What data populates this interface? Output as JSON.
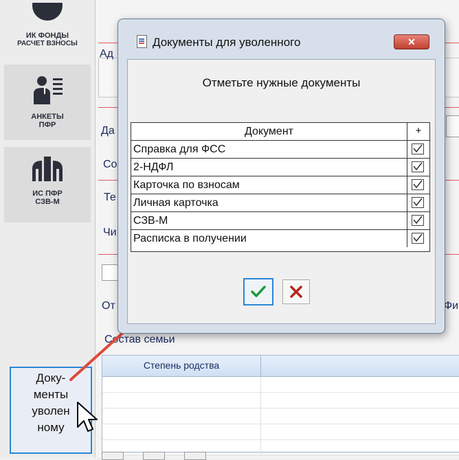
{
  "sidebar": {
    "items": [
      {
        "icon": "ik-funds-icon",
        "label_line1": "ИК ФОНДЫ",
        "label_line2": "РАСЧЕТ ВЗНОСЫ"
      },
      {
        "icon": "person-list-icon",
        "label_line1": "АНКЕТЫ",
        "label_line2": "ПФР"
      },
      {
        "icon": "pfr-logo-icon",
        "label_line1": "ИС ПФР",
        "label_line2": "СЗВ-М"
      }
    ],
    "docs_button": {
      "lines": [
        "Доку-",
        "менты",
        "уволен",
        "ному"
      ]
    }
  },
  "form": {
    "labels": {
      "address": "Ад",
      "date": "Да",
      "sostav": "Со",
      "phone": "Те",
      "chislo": "Чи",
      "otch": "От",
      "fi": "Фи"
    },
    "family_caption": "Состав семьи",
    "family_table": {
      "columns": [
        "Степень родства",
        ""
      ],
      "row_count": 5
    }
  },
  "dialog": {
    "title": "Документы для уволенного",
    "close_label": "✕",
    "prompt": "Отметьте нужные документы",
    "table": {
      "header_doc": "Документ",
      "header_plus": "+",
      "rows": [
        {
          "name": "Справка для ФСС",
          "checked": true
        },
        {
          "name": "2-НДФЛ",
          "checked": true
        },
        {
          "name": "Карточка по взносам",
          "checked": true
        },
        {
          "name": "Личная карточка",
          "checked": true
        },
        {
          "name": "СЗВ-М",
          "checked": true
        },
        {
          "name": "Расписка в получении",
          "checked": true
        }
      ]
    },
    "ok_icon": "checkmark-icon",
    "cancel_icon": "x-icon"
  },
  "colors": {
    "accent_blue": "#2a86d8",
    "arrow_red": "#e04a3a",
    "ok_green": "#1d9a3a",
    "cancel_red": "#b3261e"
  }
}
